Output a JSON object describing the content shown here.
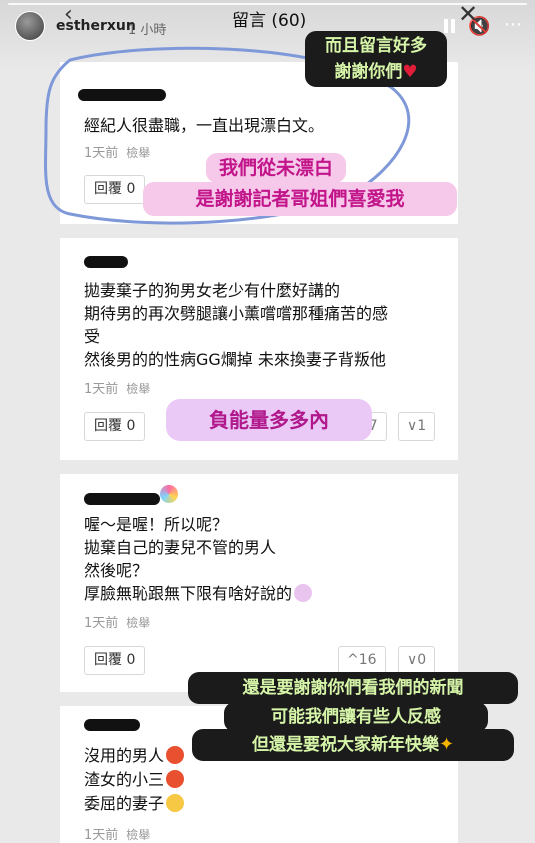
{
  "story": {
    "username": "estherxun",
    "time_ago": "1 小時",
    "title": "留言 (60)"
  },
  "labels": {
    "time_1day": "1天前",
    "report": "檢舉",
    "reply": "回覆 0"
  },
  "comments": [
    {
      "lines": [
        "經紀人很盡職，一直出現漂白文。"
      ]
    },
    {
      "lines": [
        "拋妻棄子的狗男女老少有什麼好講的",
        "期待男的再次劈腿讓小薰嚐嚐那種痛苦的感",
        "受",
        "然後男的的性病GG爛掉 未來換妻子背叛他"
      ],
      "up": "7",
      "down": "1"
    },
    {
      "lines": [
        "喔～是喔！所以呢？",
        "拋棄自己的妻兒不管的男人",
        "然後呢？",
        "厚臉無恥跟無下限有啥好說的"
      ],
      "up": "16",
      "down": "0"
    },
    {
      "lines": [
        "沒用的男人",
        "渣女的小三",
        "委屈的妻子"
      ]
    }
  ],
  "stickers": {
    "top_dark": [
      "而且留言好多",
      "謝謝你們"
    ],
    "pink": [
      "我們從未漂白",
      "是謝謝記者哥姐們喜愛我"
    ],
    "purple": "負能量多多內",
    "bottom_dark": [
      "還是要謝謝你們看我們的新聞",
      "可能我們讓有些人反感",
      "但還是要祝大家新年快樂"
    ]
  },
  "colors": {
    "sticker_dark_bg": "#1b1b1b",
    "sticker_dark_text": "#d6f5a8",
    "sticker_pink_bg": "#f6c8ea",
    "sticker_pink_text": "#c2158a",
    "sticker_purple_bg": "#eac9f7",
    "loop_blue": "#7f98d8"
  },
  "icons": [
    "back-chevron-icon",
    "pause-icon",
    "mute-icon",
    "close-icon",
    "more-icon",
    "heart-icon",
    "party-popper-icon",
    "thumb-up-icon",
    "thumb-down-icon"
  ]
}
